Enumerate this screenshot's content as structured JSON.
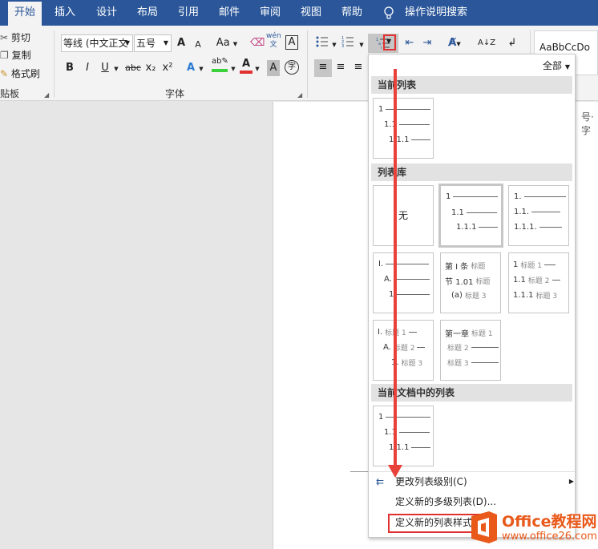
{
  "tabs": [
    {
      "label": "开始",
      "active": true
    },
    {
      "label": "插入"
    },
    {
      "label": "设计"
    },
    {
      "label": "布局"
    },
    {
      "label": "引用"
    },
    {
      "label": "邮件"
    },
    {
      "label": "审阅"
    },
    {
      "label": "视图"
    },
    {
      "label": "帮助"
    }
  ],
  "tellme": "操作说明搜索",
  "clipboard": {
    "cut": "剪切",
    "copy": "复制",
    "format_painter": "格式刷",
    "group": "贴板"
  },
  "font": {
    "family": "等线 (中文正文",
    "size": "五号",
    "group": "字体",
    "bold": "B",
    "italic": "I",
    "underline": "U",
    "strike": "abc",
    "subscript": "x₂",
    "superscript": "x²",
    "grow": "A",
    "shrink": "A",
    "case": "Aa",
    "phonetic": "wén\n文",
    "border_char": "A",
    "shade_char": "A",
    "enclose": "字"
  },
  "styles": {
    "preview": "AaBbCcDo"
  },
  "page_side_text": "号·字",
  "menu": {
    "filter": "全部",
    "sections": {
      "current": "当前列表",
      "library": "列表库",
      "in_doc": "当前文档中的列表"
    },
    "none_label": "无",
    "items": {
      "change_level": "更改列表级别(C)",
      "define_multilevel": "定义新的多级列表(D)...",
      "define_style": "定义新的列表样式(L)..."
    }
  },
  "thumbs": {
    "numeric": [
      "1",
      "1.1",
      "1.1.1"
    ],
    "alpha1": [
      "1.",
      "1.1.",
      "1.1.1."
    ],
    "roman": [
      "I.",
      "A.",
      "1"
    ],
    "article": [
      "第 Ⅰ 条",
      "节 1.01",
      "(a)"
    ],
    "article_caps": [
      "标题",
      "标题",
      "标题 3"
    ],
    "heading_num": [
      "1",
      "1.1",
      "1.1.1"
    ],
    "heading_caps": [
      "标题 1",
      "标题 2",
      "标题 3"
    ],
    "roman_heading": [
      "I.",
      "A.",
      "1."
    ],
    "chapter": [
      "第一章",
      "",
      ""
    ],
    "chapter_caps": [
      "标题 1",
      "标题 2",
      "标题 3"
    ]
  },
  "watermark": {
    "brand": "Office教程网",
    "url": "www.office26.com"
  },
  "colors": {
    "tab_blue": "#2b579a",
    "red_annot": "#e03030",
    "watermark_orange": "#e8591a"
  }
}
